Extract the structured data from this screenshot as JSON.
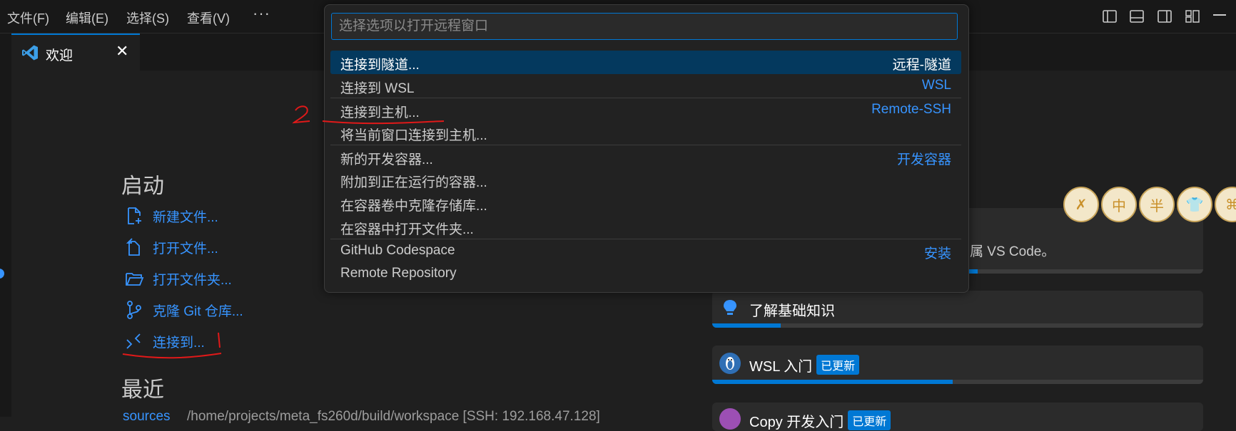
{
  "menubar": {
    "items": [
      "文件(F)",
      "编辑(E)",
      "选择(S)",
      "查看(V)"
    ],
    "more": "···"
  },
  "tab": {
    "label": "欢迎",
    "close": "✕"
  },
  "welcome": {
    "start_title": "启动",
    "start_items": [
      {
        "label": "新建文件...",
        "icon": "new-file-icon"
      },
      {
        "label": "打开文件...",
        "icon": "open-file-icon"
      },
      {
        "label": "打开文件夹...",
        "icon": "open-folder-icon"
      },
      {
        "label": "克隆 Git 仓库...",
        "icon": "git-branch-icon"
      },
      {
        "label": "连接到...",
        "icon": "remote-icon"
      }
    ],
    "recent_title": "最近",
    "recent_items": [
      {
        "name": "sources",
        "path": "/home/projects/meta_fs260d/build/workspace [SSH: 192.168.47.128]"
      }
    ]
  },
  "walkthroughs": {
    "card1_text": "专属 VS Code。",
    "card1_progress": 0.54,
    "card2": {
      "title": "了解基础知识",
      "progress": 0.14
    },
    "card3": {
      "title": "WSL 入门",
      "badge": "已更新",
      "progress": 0.49
    },
    "card4": {
      "title": "Copy 开发入门",
      "badge": "已更新"
    }
  },
  "stamps": [
    "✗",
    "中",
    "半",
    "👕",
    "⌘"
  ],
  "quickpick": {
    "placeholder": "选择选项以打开远程窗口",
    "items": [
      {
        "label": "连接到隧道...",
        "detail": "远程-隧道",
        "selected": true
      },
      {
        "label": "连接到 WSL",
        "detail": "WSL"
      },
      {
        "label": "连接到主机...",
        "detail": "Remote-SSH"
      },
      {
        "label": "将当前窗口连接到主机...",
        "detail": ""
      },
      {
        "label": "新的开发容器...",
        "detail": "开发容器"
      },
      {
        "label": "附加到正在运行的容器...",
        "detail": ""
      },
      {
        "label": "在容器卷中克隆存储库...",
        "detail": ""
      },
      {
        "label": "在容器中打开文件夹...",
        "detail": ""
      },
      {
        "label": "GitHub Codespace",
        "detail": "安装"
      },
      {
        "label": "Remote Repository",
        "detail": ""
      }
    ]
  },
  "annotations": {
    "one": "1",
    "two": "2"
  },
  "colors": {
    "accent": "#0078d4",
    "link": "#3794ff",
    "annotation": "#e01919"
  }
}
